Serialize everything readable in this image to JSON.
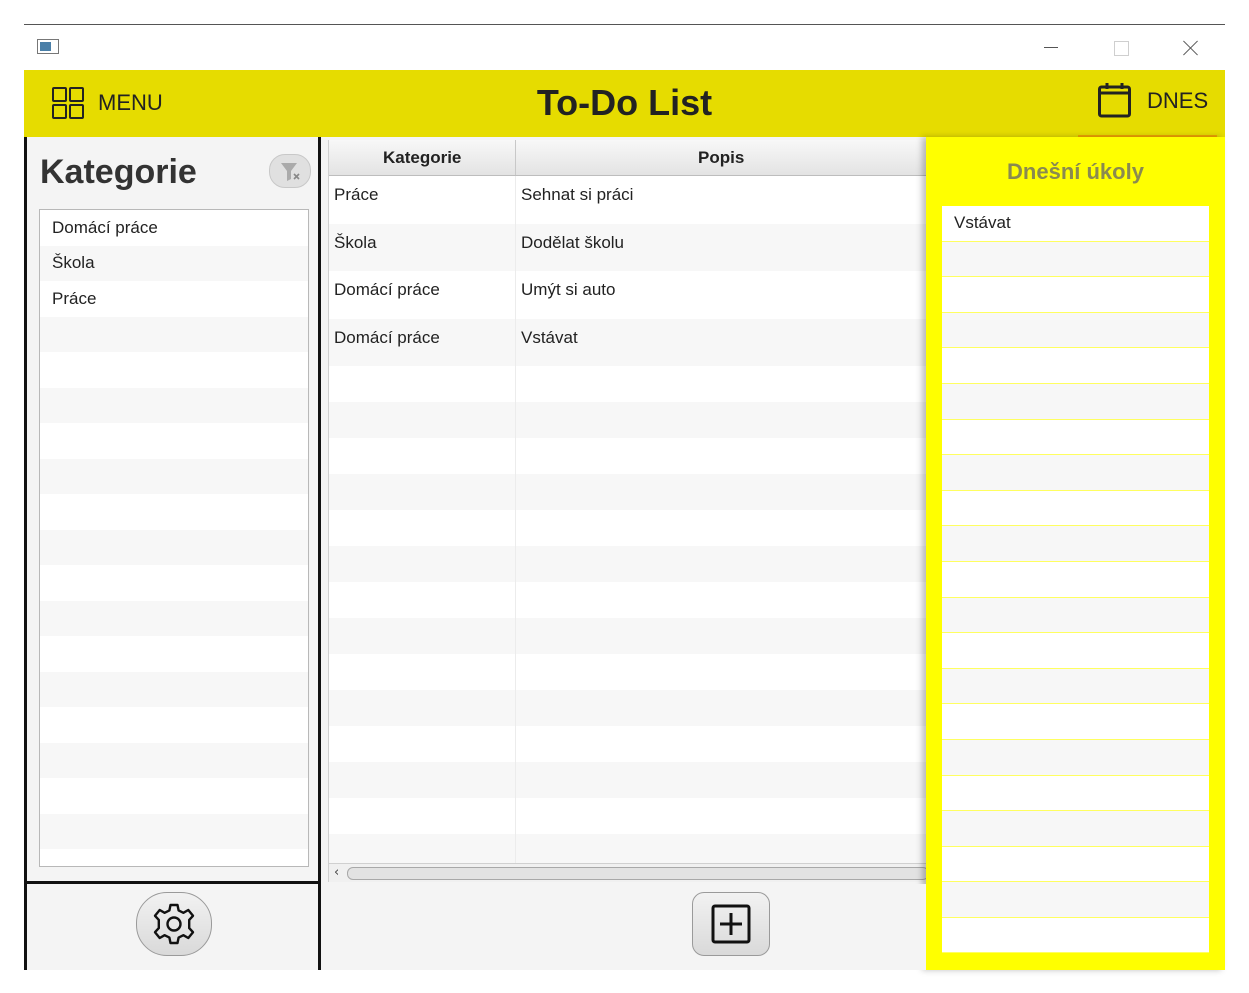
{
  "header": {
    "menu_label": "MENU",
    "title": "To-Do List",
    "dnes_label": "DNES",
    "accent": "#e6dc00",
    "highlight": "#f0a400"
  },
  "categories": {
    "title": "Kategorie",
    "items": [
      "Domácí práce",
      "Škola",
      "Práce"
    ]
  },
  "table": {
    "columns": [
      "Kategorie",
      "Popis"
    ],
    "rows": [
      [
        "Práce",
        "Sehnat si práci"
      ],
      [
        "Škola",
        "Dodělat školu"
      ],
      [
        "Domácí práce",
        "Umýt si auto"
      ],
      [
        "Domácí práce",
        "Vstávat"
      ]
    ]
  },
  "today": {
    "title": "Dnešní úkoly",
    "items": [
      "Vstávat"
    ],
    "color": "#ffff00"
  },
  "icons": {
    "menu": "grid-icon",
    "today": "calendar-icon",
    "filter": "filter-clear-icon",
    "settings": "gear-icon",
    "add": "plus-square-icon"
  }
}
